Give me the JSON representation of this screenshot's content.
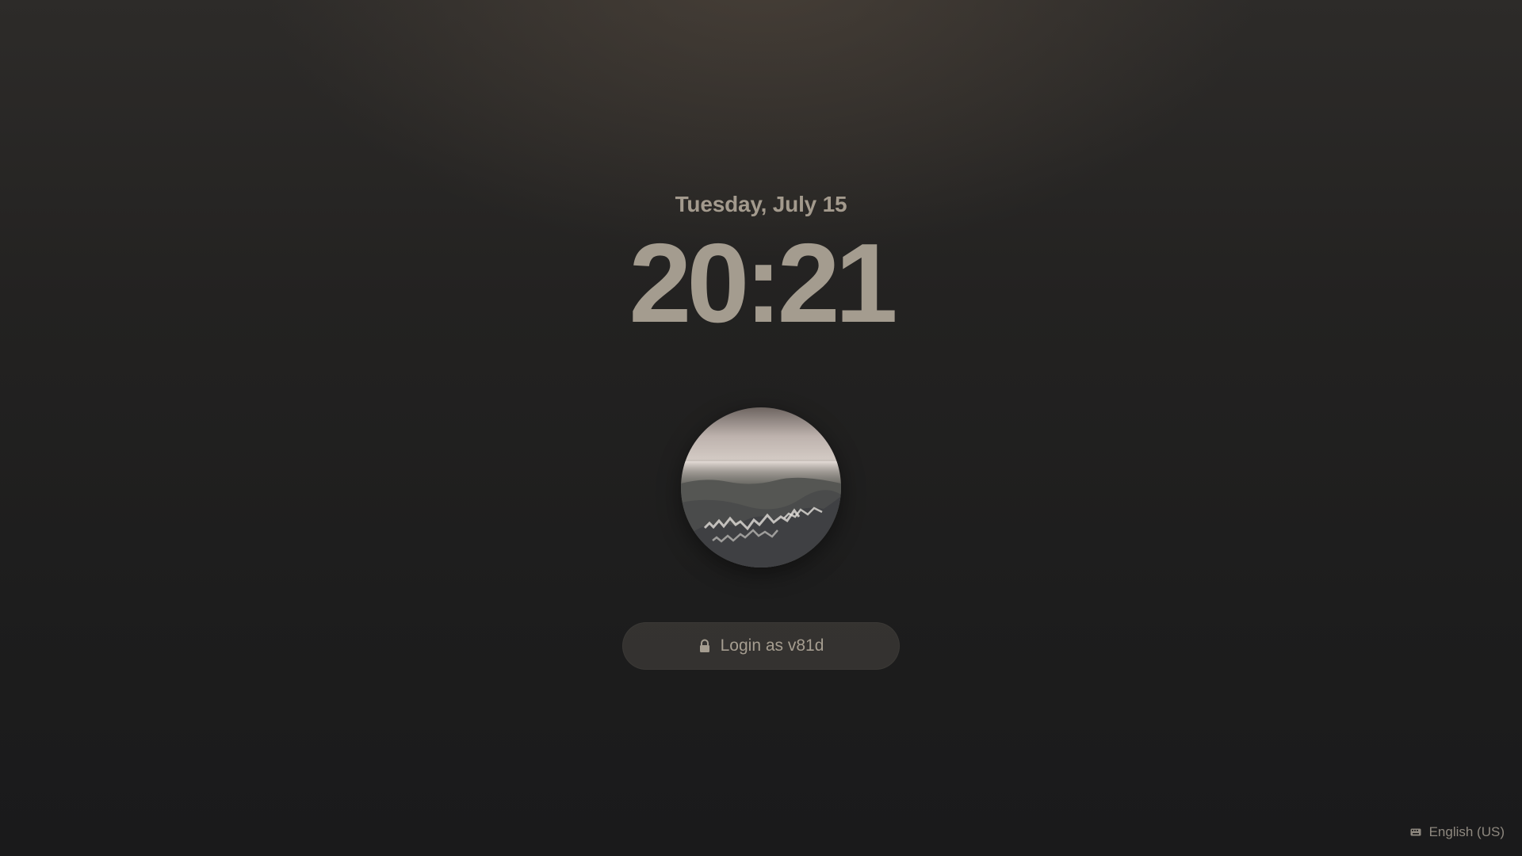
{
  "lockscreen": {
    "date": "Tuesday, July 15",
    "time": "20:21",
    "avatar_description": "user-avatar",
    "login_label": "Login as v81d",
    "login_icon": "lock-icon",
    "keyboard_layout": "English (US)",
    "keyboard_icon": "keyboard-icon"
  },
  "colors": {
    "background_top": "#2d2b29",
    "background_bottom": "#1a1a1b",
    "text": "#a49c8f",
    "button_bg": "#3a3834"
  }
}
